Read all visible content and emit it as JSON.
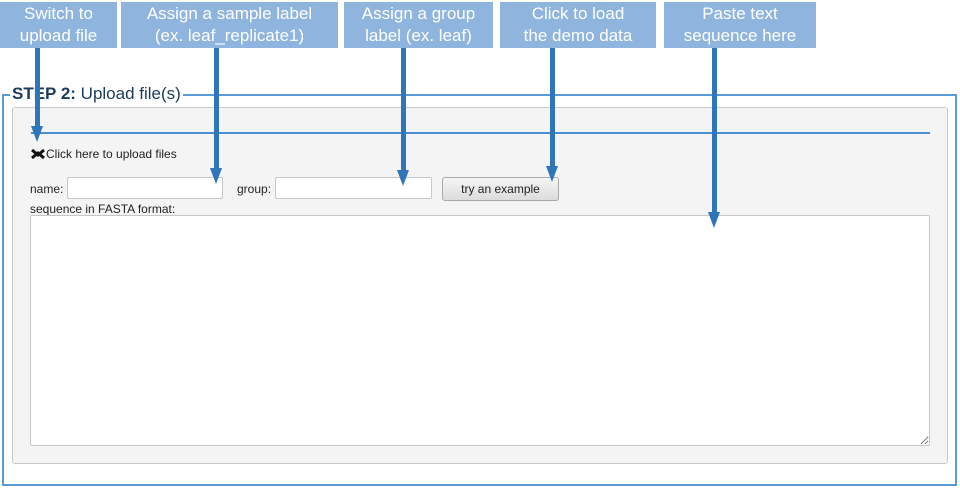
{
  "callouts": [
    {
      "line1": "Switch to",
      "line2": "upload file"
    },
    {
      "line1": "Assign a sample label",
      "line2": "(ex. leaf_replicate1)"
    },
    {
      "line1": "Assign a group",
      "line2": "label  (ex. leaf)"
    },
    {
      "line1": "Click to load",
      "line2": "the demo data"
    },
    {
      "line1": "Paste text",
      "line2": "sequence here"
    }
  ],
  "step": {
    "number_label": "STEP 2:",
    "title": " Upload file(s)"
  },
  "upload_toggle": {
    "icon": "collapse-toggle-icon",
    "label": "Click here to upload files"
  },
  "form": {
    "name_label": "name:",
    "name_value": "",
    "group_label": "group:",
    "group_value": "",
    "example_button": "try an example",
    "sequence_label": "sequence in FASTA format:",
    "sequence_value": ""
  },
  "colors": {
    "callout_bg": "#8fb5de",
    "arrow": "#2f75b9",
    "frame": "#5b9bd5"
  }
}
